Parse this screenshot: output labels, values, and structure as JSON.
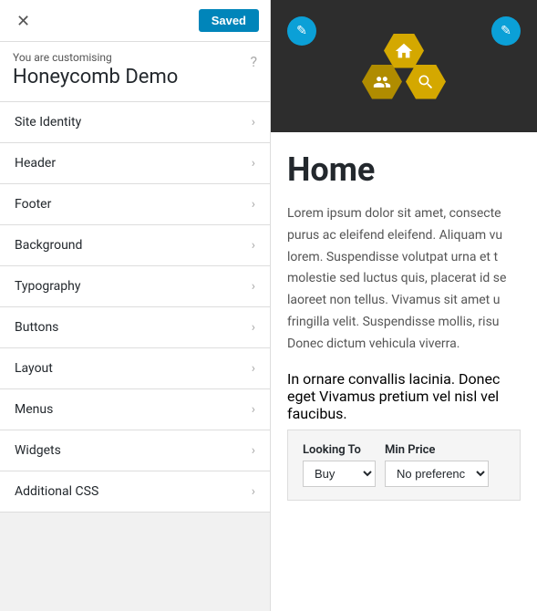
{
  "topBar": {
    "closeLabel": "✕",
    "savedLabel": "Saved"
  },
  "customising": {
    "label": "You are customising",
    "siteTitle": "Honeycomb Demo",
    "helpIcon": "?"
  },
  "menuItems": [
    {
      "id": "site-identity",
      "label": "Site Identity"
    },
    {
      "id": "header",
      "label": "Header"
    },
    {
      "id": "footer",
      "label": "Footer"
    },
    {
      "id": "background",
      "label": "Background"
    },
    {
      "id": "typography",
      "label": "Typography"
    },
    {
      "id": "buttons",
      "label": "Buttons"
    },
    {
      "id": "layout",
      "label": "Layout"
    },
    {
      "id": "menus",
      "label": "Menus"
    },
    {
      "id": "widgets",
      "label": "Widgets"
    },
    {
      "id": "additional-css",
      "label": "Additional CSS"
    }
  ],
  "preview": {
    "homeTitle": "Home",
    "loremText": "Lorem ipsum dolor sit amet, consecte purus ac eleifend eleifend. Aliquam vu lorem. Suspendisse volutpat urna et t molestie sed luctus quis, placerat id se laoreet non tellus. Vivamus sit amet u fringilla velit. Suspendisse mollis, risu Donec dictum vehicula viverra.",
    "loremText2": "In ornare convallis lacinia. Donec eget Vivamus pretium vel nisl vel faucibus.",
    "searchWidget": {
      "lookingToLabel": "Looking To",
      "minPriceLabel": "Min Price",
      "lookingToOptions": [
        "Buy"
      ],
      "minPriceOptions": [
        "No preferenc"
      ],
      "lookingToDefault": "Buy",
      "minPriceDefault": "No preferenc"
    }
  },
  "editIcon": "✎"
}
